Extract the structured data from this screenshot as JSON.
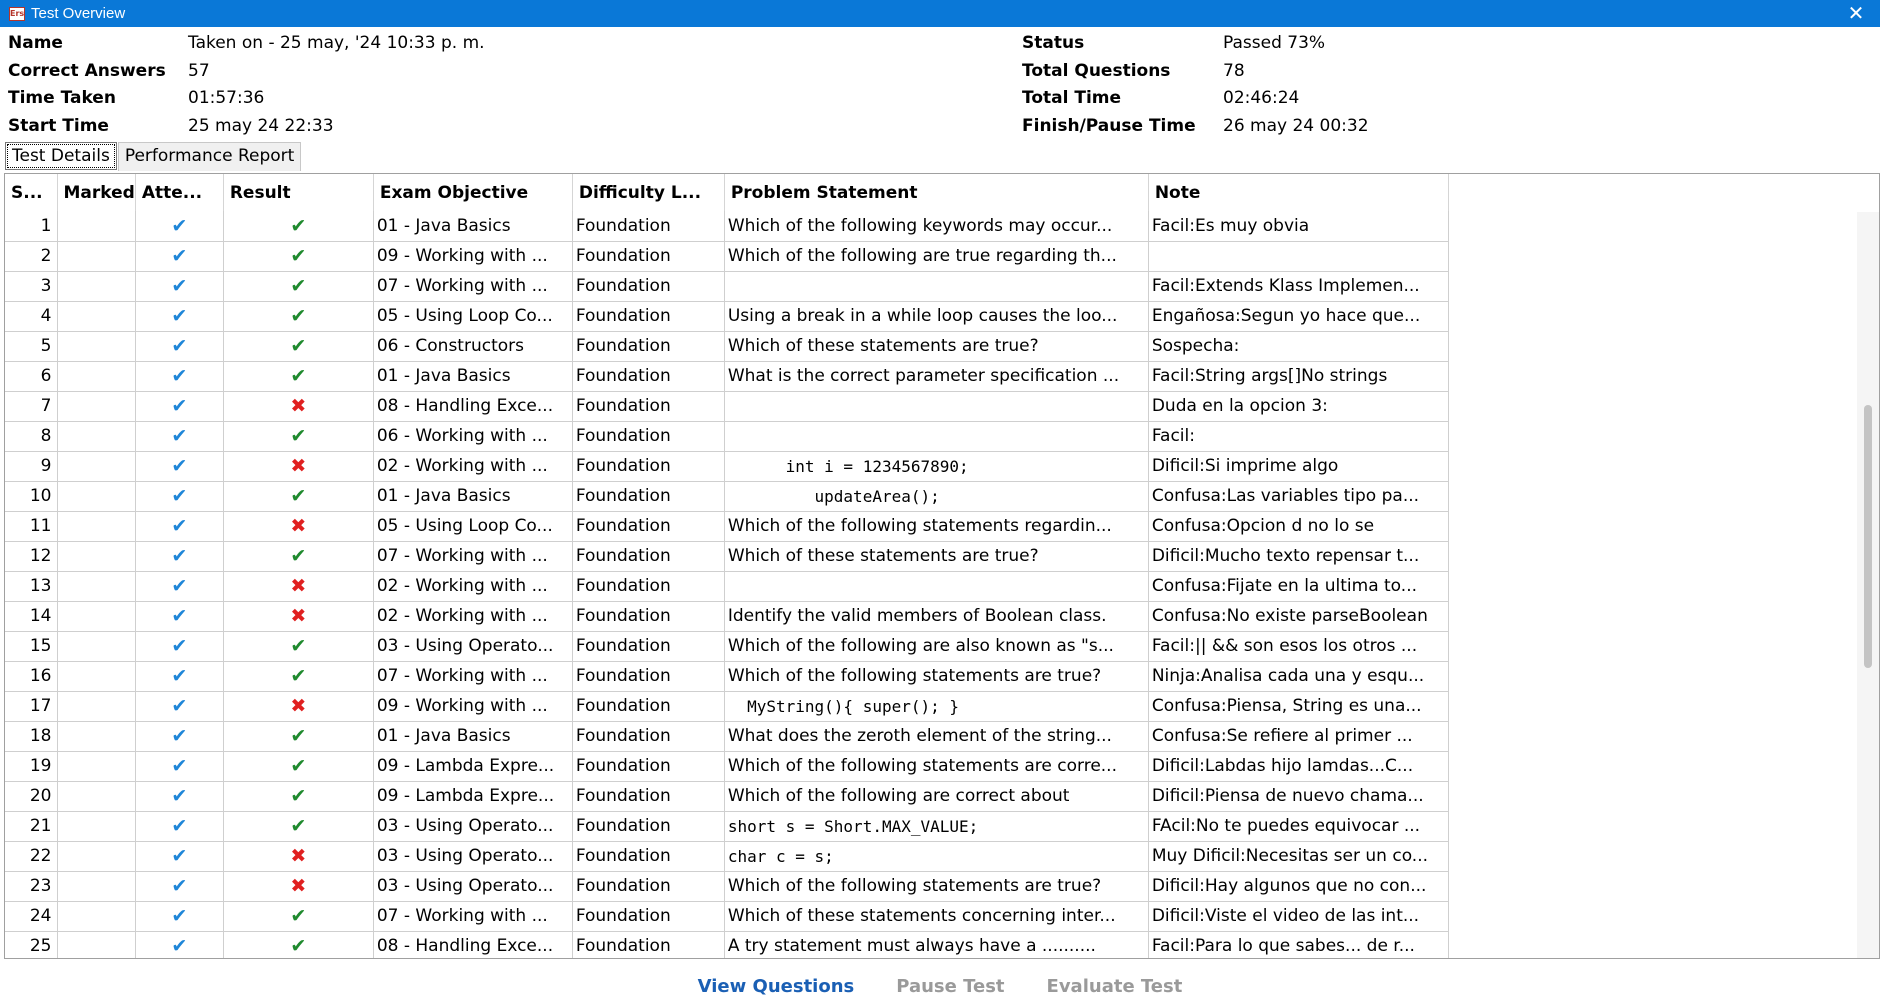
{
  "window": {
    "title": "Test Overview",
    "icon_text": "Ers"
  },
  "info_left": [
    {
      "label": "Name",
      "value": "Taken on - 25 may, '24 10:33 p. m."
    },
    {
      "label": "Correct Answers",
      "value": "57"
    },
    {
      "label": "Time Taken",
      "value": "01:57:36"
    },
    {
      "label": "Start Time",
      "value": "25 may 24 22:33"
    }
  ],
  "info_right": [
    {
      "label": "Status",
      "value": "Passed 73%"
    },
    {
      "label": "Total Questions",
      "value": "78"
    },
    {
      "label": "Total Time",
      "value": "02:46:24"
    },
    {
      "label": "Finish/Pause Time",
      "value": "26 may 24 00:32"
    }
  ],
  "tabs": [
    "Test Details",
    "Performance Report"
  ],
  "columns": [
    "S...",
    "Marked",
    "Atte...",
    "Result",
    "Exam Objective",
    "Difficulty L...",
    "Problem Statement",
    "Note"
  ],
  "rows": [
    {
      "n": "1",
      "result": "ok",
      "objective": "01 - Java Basics",
      "difficulty": "Foundation",
      "problem": "Which of the following keywords may occur...",
      "note": "Facil:Es muy obvia"
    },
    {
      "n": "2",
      "result": "ok",
      "objective": "09 - Working with ...",
      "difficulty": "Foundation",
      "problem": "Which of the following are true regarding th...",
      "note": ""
    },
    {
      "n": "3",
      "result": "ok",
      "objective": "07 - Working with ...",
      "difficulty": "Foundation",
      "problem": "",
      "note": "Facil:Extends Klass Implemen..."
    },
    {
      "n": "4",
      "result": "ok",
      "objective": "05 - Using Loop Co...",
      "difficulty": "Foundation",
      "problem": "Using a break in a while loop causes the loo...",
      "note": "Engañosa:Segun yo hace que..."
    },
    {
      "n": "5",
      "result": "ok",
      "objective": "06 - Constructors",
      "difficulty": "Foundation",
      "problem": "Which of these statements are true?",
      "note": "Sospecha:"
    },
    {
      "n": "6",
      "result": "ok",
      "objective": "01 - Java Basics",
      "difficulty": "Foundation",
      "problem": "What is the correct parameter specification ...",
      "note": "Facil:String args[]No strings"
    },
    {
      "n": "7",
      "result": "bad",
      "objective": "08 - Handling Exce...",
      "difficulty": "Foundation",
      "problem": "",
      "note": "Duda en la opcion 3:"
    },
    {
      "n": "8",
      "result": "ok",
      "objective": "06 - Working with ...",
      "difficulty": "Foundation",
      "problem": "",
      "note": "Facil:"
    },
    {
      "n": "9",
      "result": "bad",
      "objective": "02 - Working with ...",
      "difficulty": "Foundation",
      "problem": "      int i = 1234567890;",
      "mono": true,
      "note": "Dificil:Si imprime algo"
    },
    {
      "n": "10",
      "result": "ok",
      "objective": "01 - Java Basics",
      "difficulty": "Foundation",
      "problem": "         updateArea();",
      "mono": true,
      "note": "Confusa:Las variables tipo pa..."
    },
    {
      "n": "11",
      "result": "bad",
      "objective": "05 - Using Loop Co...",
      "difficulty": "Foundation",
      "problem": "Which of the following statements regardin...",
      "note": "Confusa:Opcion d no lo se"
    },
    {
      "n": "12",
      "result": "ok",
      "objective": "07 - Working with ...",
      "difficulty": "Foundation",
      "problem": "Which of these statements are true?",
      "note": "Dificil:Mucho texto repensar t..."
    },
    {
      "n": "13",
      "result": "bad",
      "objective": "02 - Working with ...",
      "difficulty": "Foundation",
      "problem": "",
      "note": "Confusa:Fijate en la ultima to..."
    },
    {
      "n": "14",
      "result": "bad",
      "objective": "02 - Working with ...",
      "difficulty": "Foundation",
      "problem": "Identify the valid members of Boolean class.",
      "note": "Confusa:No existe parseBoolean"
    },
    {
      "n": "15",
      "result": "ok",
      "objective": "03 - Using Operato...",
      "difficulty": "Foundation",
      "problem": "Which of the following are also known as \"s...",
      "note": "Facil:|| && son esos los otros ..."
    },
    {
      "n": "16",
      "result": "ok",
      "objective": "07 - Working with ...",
      "difficulty": "Foundation",
      "problem": "Which of the following statements are true?",
      "note": "Ninja:Analisa cada una y esqu..."
    },
    {
      "n": "17",
      "result": "bad",
      "objective": "09 - Working with ...",
      "difficulty": "Foundation",
      "problem": "  MyString(){ super(); }",
      "mono": true,
      "note": "Confusa:Piensa, String es una..."
    },
    {
      "n": "18",
      "result": "ok",
      "objective": "01 - Java Basics",
      "difficulty": "Foundation",
      "problem": "What does the zeroth element of the string...",
      "note": "Confusa:Se refiere al primer ..."
    },
    {
      "n": "19",
      "result": "ok",
      "objective": "09 - Lambda Expre...",
      "difficulty": "Foundation",
      "problem": "Which of the following statements are corre...",
      "note": "Dificil:Labdas hijo lamdas...C..."
    },
    {
      "n": "20",
      "result": "ok",
      "objective": "09 - Lambda Expre...",
      "difficulty": "Foundation",
      "problem": "Which of the following are correct about",
      "note": "Dificil:Piensa de nuevo chama..."
    },
    {
      "n": "21",
      "result": "ok",
      "objective": "03 - Using Operato...",
      "difficulty": "Foundation",
      "problem": "short s = Short.MAX_VALUE;",
      "mono": true,
      "note": "FAcil:No te puedes equivocar ..."
    },
    {
      "n": "22",
      "result": "bad",
      "objective": "03 - Using Operato...",
      "difficulty": "Foundation",
      "problem": "char c = s;",
      "mono": true,
      "note": "Muy Dificil:Necesitas ser un co..."
    },
    {
      "n": "23",
      "result": "bad",
      "objective": "03 - Using Operato...",
      "difficulty": "Foundation",
      "problem": "Which of the following statements are true?",
      "note": "Dificil:Hay algunos que no con..."
    },
    {
      "n": "24",
      "result": "ok",
      "objective": "07 - Working with ...",
      "difficulty": "Foundation",
      "problem": "Which of these statements concerning inter...",
      "note": "Dificil:Viste el video de las int..."
    },
    {
      "n": "25",
      "result": "ok",
      "objective": "08 - Handling Exce...",
      "difficulty": "Foundation",
      "problem": "A try statement must always have a ..........",
      "note": "Facil:Para lo que sabes... de r..."
    }
  ],
  "icons": {
    "attempted": "checkmark-icon",
    "correct": "green-check-icon",
    "wrong": "red-x-icon"
  },
  "colors": {
    "titlebar": "#0a78d7",
    "checkmark": "#1e86d8",
    "correct": "#1f8a2e",
    "wrong": "#e02020",
    "link": "#1a5fb4",
    "disabled": "#9a9a9a"
  },
  "buttons": {
    "view": "View Questions",
    "pause": "Pause Test",
    "evaluate": "Evaluate Test"
  }
}
